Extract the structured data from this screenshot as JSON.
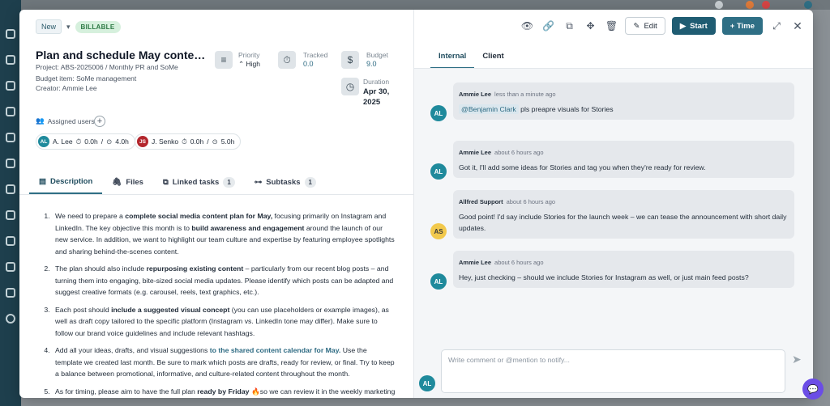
{
  "badges": {
    "new": "New",
    "billable": "BILLABLE"
  },
  "task": {
    "title": "Plan and schedule May content for I...",
    "project": "Project: ABS-2025006 / Monthly PR and SoMe",
    "budget_item": "Budget item: SoMe management",
    "creator": "Creator: Ammie Lee"
  },
  "stats": {
    "priority_label": "Priority",
    "priority_value": "High",
    "tracked_label": "Tracked",
    "tracked_value": "0.0",
    "budget_label": "Budget",
    "budget_value": "9.0",
    "duration_label": "Duration",
    "duration_value_1": "Apr 30,",
    "duration_value_2": "2025"
  },
  "assigned": {
    "label": "Assigned users",
    "users": [
      {
        "initials": "AL",
        "name": "A. Lee",
        "tracked": "0.0h",
        "sep": "/",
        "budget": "4.0h",
        "color": "#1f8a9c"
      },
      {
        "initials": "JS",
        "name": "J. Senko",
        "tracked": "0.0h",
        "sep": "/",
        "budget": "5.0h",
        "color": "#b3262d"
      }
    ]
  },
  "tabs": {
    "description": "Description",
    "files": "Files",
    "linked": "Linked tasks",
    "linked_count": "1",
    "subtasks": "Subtasks",
    "subtasks_count": "1"
  },
  "description": {
    "items": [
      {
        "p1": "We need to prepare a ",
        "b1": "complete social media content plan for May,",
        "p2": " focusing primarily on Instagram and LinkedIn. The key objective this month is to ",
        "b2": "build awareness and engagement",
        "p3": " around the launch of our new service. In addition, we want to highlight our team culture and expertise by featuring employee spotlights and sharing behind-the-scenes content."
      },
      {
        "p1": "The plan should also include ",
        "b1": "repurposing existing content",
        "p2": " – particularly from our recent blog posts – and turning them into engaging, bite-sized social media updates. Please identify which posts can be adapted and suggest creative formats (e.g. carousel, reels, text graphics, etc.).",
        "b2": "",
        "p3": ""
      },
      {
        "p1": "Each post should ",
        "b1": "include a suggested visual concept",
        "p2": " (you can use placeholders or example images), as well as draft copy tailored to the specific platform (Instagram vs. LinkedIn tone may differ). Make sure to follow our brand voice guidelines and include relevant hashtags.",
        "b2": "",
        "p3": ""
      },
      {
        "p1": "Add all your ideas, drafts, and visual suggestions ",
        "b1": "to the shared content calendar for May.",
        "p2": " Use the template we created last month. Be sure to mark which posts are drafts, ready for review, or final. Try to keep a balance between promotional, informative, and culture-related content throughout the month.",
        "b2": "",
        "p3": ""
      },
      {
        "p1": "As for timing, please aim to have the full plan ",
        "b1": "ready by Friday",
        "p2": " 🔥so we can review it in the weekly marketing",
        "b2": "",
        "p3": ""
      }
    ]
  },
  "toolbar": {
    "edit": "Edit",
    "start": "Start",
    "time": "+ Time"
  },
  "right_tabs": {
    "internal": "Internal",
    "client": "Client"
  },
  "messages": [
    {
      "author": "Ammie Lee",
      "time": "less than a minute ago",
      "mention": "@Benjamin Clark",
      "text": " pls preapre visuals for Stories",
      "initials": "AL",
      "color": "#1f8a9c"
    },
    {
      "author": "Ammie Lee",
      "time": "about 6 hours ago",
      "mention": "",
      "text": "Got it, I'll add some ideas for Stories and tag you when they're ready for review.",
      "initials": "AL",
      "color": "#1f8a9c"
    },
    {
      "author": "Allfred Support",
      "time": "about 6 hours ago",
      "mention": "",
      "text": "Good point! I'd say include Stories for the launch week – we can tease the announcement with short daily updates.",
      "initials": "AS",
      "color": "#f2c94c"
    },
    {
      "author": "Ammie Lee",
      "time": "about 6 hours ago",
      "mention": "",
      "text": "Hey, just checking – should we include Stories for Instagram as well, or just main feed posts?",
      "initials": "AL",
      "color": "#1f8a9c"
    }
  ],
  "compose": {
    "placeholder": "Write comment or @mention to notify...",
    "me_initials": "AL"
  }
}
